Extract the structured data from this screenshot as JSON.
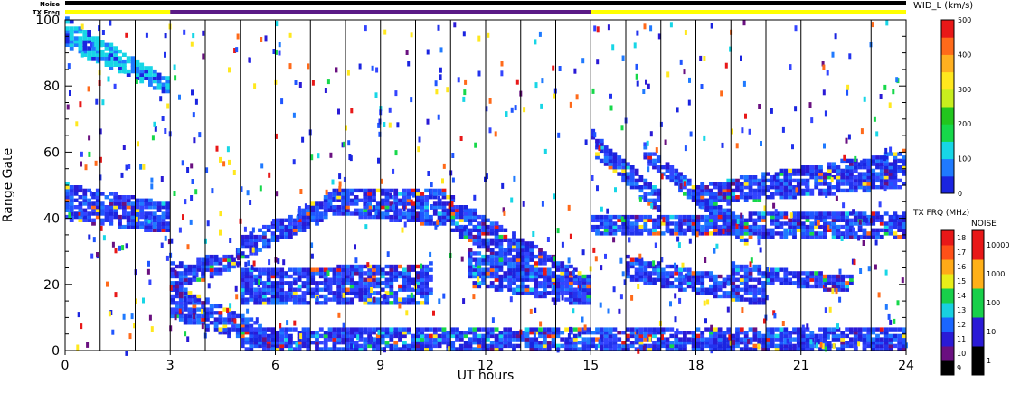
{
  "chart_data": {
    "type": "heatmap",
    "xlabel": "UT hours",
    "ylabel": "Range Gate",
    "xlim": [
      0,
      24
    ],
    "ylim": [
      0,
      100
    ],
    "x_ticks": [
      0,
      3,
      6,
      9,
      12,
      15,
      18,
      21,
      24
    ],
    "y_ticks": [
      0,
      20,
      40,
      60,
      80,
      100
    ],
    "hour_gridlines": [
      1,
      2,
      3,
      4,
      5,
      6,
      7,
      8,
      9,
      10,
      11,
      12,
      13,
      14,
      15,
      16,
      17,
      18,
      19,
      20,
      21,
      22,
      23
    ],
    "top_bars": {
      "noise_label": "Noise",
      "txfreq_label": "TX Freq",
      "noise_color": "#000000",
      "txfreq_segments": [
        {
          "start": 0,
          "end": 3,
          "color": "#ffff00"
        },
        {
          "start": 3,
          "end": 15,
          "color": "#5a1a86"
        },
        {
          "start": 15,
          "end": 24,
          "color": "#ffff00"
        }
      ]
    },
    "width_scale": {
      "title": "WID_L (km/s)",
      "ticks": [
        0,
        100,
        200,
        300,
        400,
        500
      ],
      "colors": [
        "#1a24e0",
        "#1f7aff",
        "#17d6e6",
        "#16d84a",
        "#22c61e",
        "#c8ee1e",
        "#ffe81e",
        "#ffb020",
        "#ff6a1a",
        "#e81818"
      ]
    },
    "txfreq_scale": {
      "title": "TX FRQ (MHz)",
      "ticks": [
        9,
        10,
        11,
        12,
        13,
        14,
        15,
        16,
        17,
        18
      ],
      "colors": [
        "#000000",
        "#6a1080",
        "#2a1ad6",
        "#1a66ff",
        "#18d0e0",
        "#18d04a",
        "#e8ee18",
        "#ffaa18",
        "#ff5018",
        "#e81818"
      ]
    },
    "noise_scale": {
      "title": "NOISE",
      "ticks": [
        "1",
        "10",
        "100",
        "1000",
        "10000"
      ],
      "colors": [
        "#000000",
        "#2a1ad6",
        "#18d04a",
        "#ffb018",
        "#e81818"
      ]
    },
    "echo_regions": [
      {
        "start": 0.0,
        "end": 3.0,
        "from": [
          40,
          50
        ],
        "to": [
          36,
          44
        ],
        "dominant": "blue"
      },
      {
        "start": 0.0,
        "end": 3.0,
        "from": [
          92,
          100
        ],
        "to": [
          78,
          82
        ],
        "dominant": "cyan"
      },
      {
        "start": 3.0,
        "end": 5.0,
        "from": [
          18,
          26
        ],
        "to": [
          26,
          30
        ],
        "dominant": "blue"
      },
      {
        "start": 3.0,
        "end": 6.0,
        "from": [
          10,
          20
        ],
        "to": [
          1,
          6
        ],
        "dominant": "blue"
      },
      {
        "start": 5.0,
        "end": 7.5,
        "from": [
          28,
          34
        ],
        "to": [
          40,
          46
        ],
        "dominant": "blue"
      },
      {
        "start": 5.0,
        "end": 10.5,
        "from": [
          14,
          24
        ],
        "to": [
          14,
          26
        ],
        "dominant": "blue"
      },
      {
        "start": 5.0,
        "end": 24.0,
        "from": [
          0,
          6
        ],
        "to": [
          0,
          6
        ],
        "dominant": "blue"
      },
      {
        "start": 7.5,
        "end": 11.0,
        "from": [
          42,
          48
        ],
        "to": [
          38,
          48
        ],
        "dominant": "blue"
      },
      {
        "start": 11.0,
        "end": 15.0,
        "from": [
          36,
          46
        ],
        "to": [
          14,
          22
        ],
        "dominant": "blue"
      },
      {
        "start": 11.5,
        "end": 15.0,
        "from": [
          20,
          30
        ],
        "to": [
          14,
          20
        ],
        "dominant": "blue"
      },
      {
        "start": 15.0,
        "end": 17.0,
        "from": [
          60,
          66
        ],
        "to": [
          42,
          48
        ],
        "dominant": "blue"
      },
      {
        "start": 16.5,
        "end": 19.5,
        "from": [
          58,
          62
        ],
        "to": [
          32,
          38
        ],
        "dominant": "blue"
      },
      {
        "start": 18.0,
        "end": 24.0,
        "from": [
          44,
          50
        ],
        "to": [
          50,
          60
        ],
        "dominant": "blue"
      },
      {
        "start": 16.0,
        "end": 20.0,
        "from": [
          22,
          28
        ],
        "to": [
          14,
          20
        ],
        "dominant": "blue"
      },
      {
        "start": 19.0,
        "end": 22.5,
        "from": [
          22,
          26
        ],
        "to": [
          18,
          22
        ],
        "dominant": "blue"
      },
      {
        "start": 15.0,
        "end": 24.0,
        "from": [
          36,
          40
        ],
        "to": [
          34,
          42
        ],
        "dominant": "blue"
      }
    ]
  }
}
